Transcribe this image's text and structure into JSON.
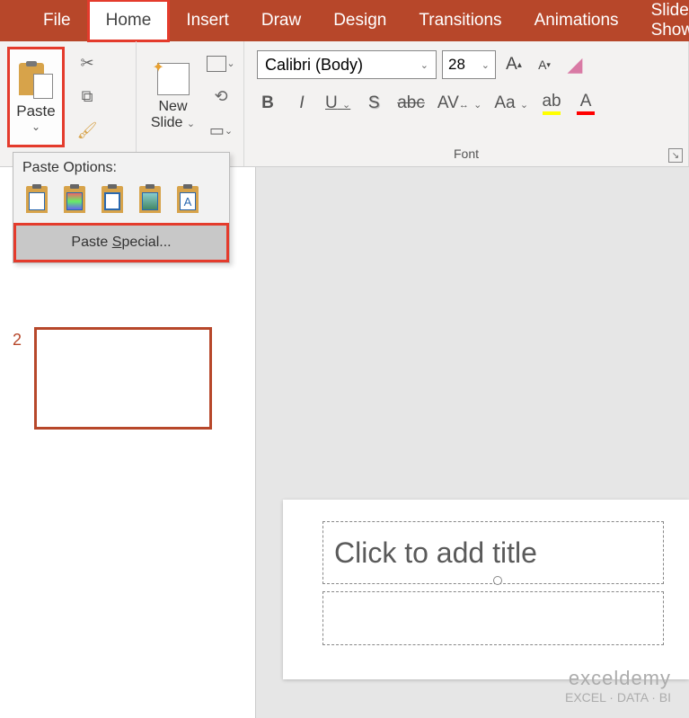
{
  "ribbon": {
    "tabs": [
      "File",
      "Home",
      "Insert",
      "Draw",
      "Design",
      "Transitions",
      "Animations",
      "Slide Show"
    ],
    "active_tab": "Home"
  },
  "clipboard": {
    "paste_label": "Paste",
    "dropdown": {
      "header": "Paste Options:",
      "special": "Paste Special..."
    }
  },
  "slides_group": {
    "new_slide": "New\nSlide"
  },
  "font": {
    "name": "Calibri (Body)",
    "size": "28",
    "group_label": "Font",
    "buttons": {
      "bold": "B",
      "italic": "I",
      "underline": "U",
      "shadow": "S",
      "strike": "abc",
      "spacing": "AV",
      "case": "Aa",
      "highlight": "ab",
      "color": "A"
    },
    "grow": "A",
    "shrink": "A"
  },
  "thumbnails": {
    "slide2_num": "2"
  },
  "slide": {
    "title_placeholder": "Click to add title"
  },
  "watermark": {
    "brand": "exceldemy",
    "tag": "EXCEL · DATA · BI"
  }
}
